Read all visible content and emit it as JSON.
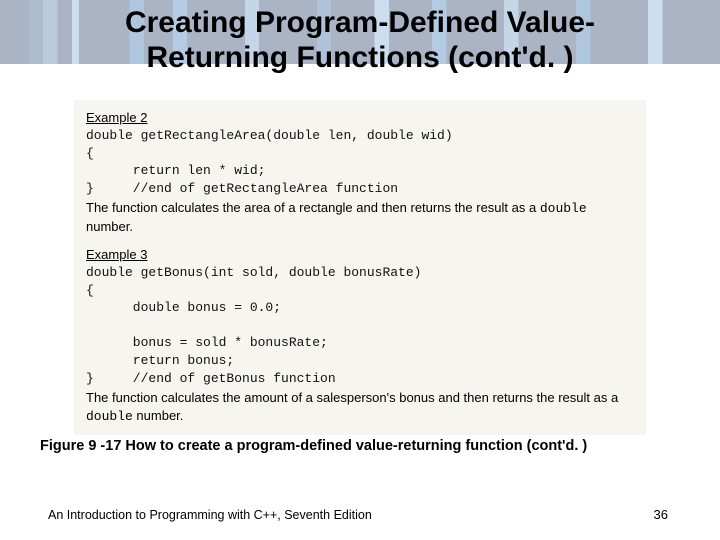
{
  "title_line1": "Creating Program-Defined Value-",
  "title_line2": "Returning Functions (cont'd. )",
  "example2": {
    "label": "Example 2",
    "code": "double getRectangleArea(double len, double wid)\n{\n      return len * wid;\n}     //end of getRectangleArea function",
    "desc_pre": "The function calculates the area of a rectangle and then returns the result as a ",
    "desc_mono": "double",
    "desc_post": " number."
  },
  "example3": {
    "label": "Example 3",
    "code": "double getBonus(int sold, double bonusRate)\n{\n      double bonus = 0.0;\n\n      bonus = sold * bonusRate;\n      return bonus;\n}     //end of getBonus function",
    "desc_pre": "The function calculates the amount of a salesperson's bonus and then returns the result as a ",
    "desc_mono": "double",
    "desc_post": " number."
  },
  "caption": "Figure 9 -17 How to create a program-defined value-returning function (cont'd. )",
  "footer_left": "An Introduction to Programming with C++, Seventh Edition",
  "footer_right": "36"
}
